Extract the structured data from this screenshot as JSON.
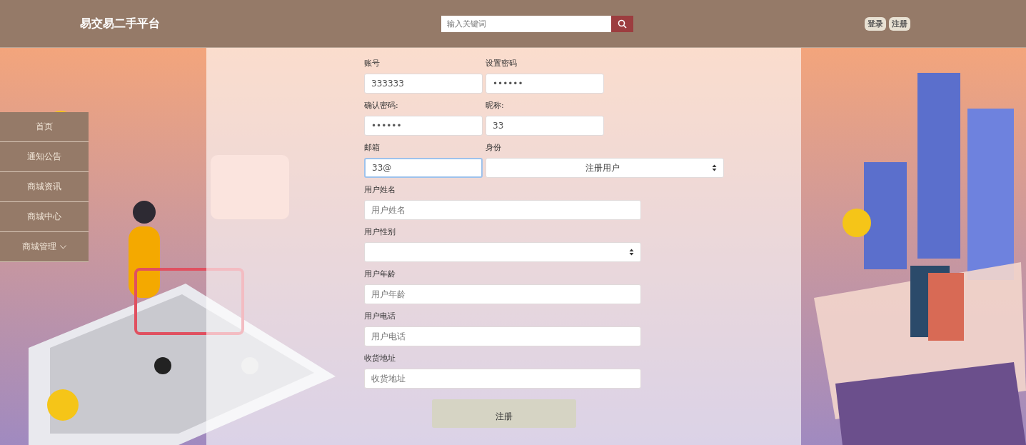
{
  "header": {
    "site_title": "易交易二手平台",
    "search": {
      "placeholder": "输入关键词"
    },
    "buttons": [
      "登录",
      "注册"
    ]
  },
  "sidebar": {
    "items": [
      {
        "label": "首页",
        "has_submenu": false
      },
      {
        "label": "通知公告",
        "has_submenu": false
      },
      {
        "label": "商城资讯",
        "has_submenu": false
      },
      {
        "label": "商城中心",
        "has_submenu": false
      },
      {
        "label": "商城管理",
        "has_submenu": true
      }
    ]
  },
  "form": {
    "rows": [
      [
        {
          "label": "账号",
          "kind": "text",
          "value": "333333",
          "focused": false
        },
        {
          "label": "设置密码",
          "kind": "password",
          "value": "••••••",
          "focused": false
        }
      ],
      [
        {
          "label": "确认密码:",
          "kind": "password",
          "value": "••••••",
          "focused": false
        },
        {
          "label": "昵称:",
          "kind": "text",
          "value": "33",
          "focused": false
        }
      ],
      [
        {
          "label": "邮箱",
          "kind": "text",
          "value": "33@",
          "focused": true
        },
        {
          "label": "身份",
          "kind": "select",
          "value": "注册用户",
          "focused": false
        }
      ],
      [
        {
          "label": "用户姓名",
          "kind": "text",
          "placeholder": "用户姓名",
          "focused": false
        }
      ],
      [
        {
          "label": "用户性别",
          "kind": "select",
          "focused": false
        }
      ],
      [
        {
          "label": "用户年龄",
          "kind": "text",
          "placeholder": "用户年龄",
          "focused": false
        }
      ],
      [
        {
          "label": "用户电话",
          "kind": "text",
          "placeholder": "用户电话",
          "focused": false
        }
      ],
      [
        {
          "label": "收货地址",
          "kind": "text",
          "placeholder": "收货地址",
          "focused": false
        }
      ]
    ],
    "submit": "注册"
  }
}
